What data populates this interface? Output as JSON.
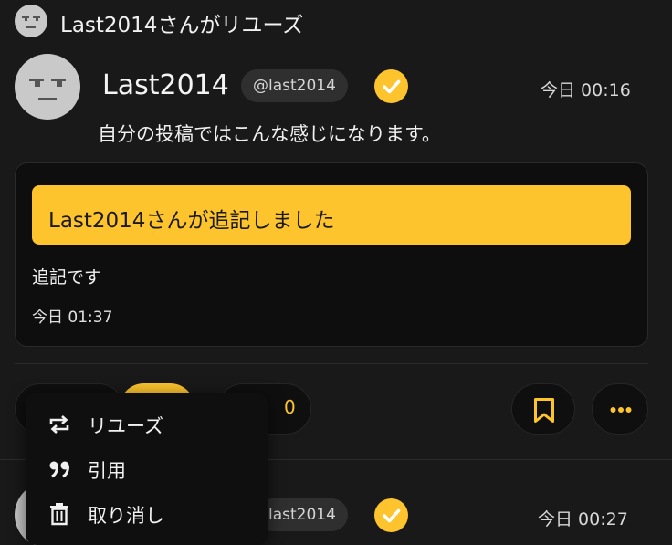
{
  "repost_header": {
    "text": "Last2014さんがリユーズ",
    "avatar_icon": "face-avatar-icon"
  },
  "post": {
    "display_name": "Last2014",
    "handle": "@last2014",
    "verified_icon": "check-badge-icon",
    "time": "今日 00:16",
    "text": "自分の投稿ではこんな感じになります。"
  },
  "addendum": {
    "banner": "Last2014さんが追記しました",
    "text": "追記です",
    "time": "今日 01:37"
  },
  "actions": {
    "reaction_count": "0",
    "bookmark_icon": "bookmark-icon",
    "more_icon": "more-dots-icon"
  },
  "menu": {
    "items": [
      {
        "icon": "repost-icon",
        "label": "リユーズ"
      },
      {
        "icon": "quote-icon",
        "label": "引用"
      },
      {
        "icon": "trash-icon",
        "label": "取り消し"
      }
    ]
  },
  "next_post": {
    "handle": "last2014",
    "time": "今日 00:27"
  },
  "colors": {
    "accent": "#fdc42e",
    "background": "#1a1919",
    "card": "#0e0e0e"
  }
}
